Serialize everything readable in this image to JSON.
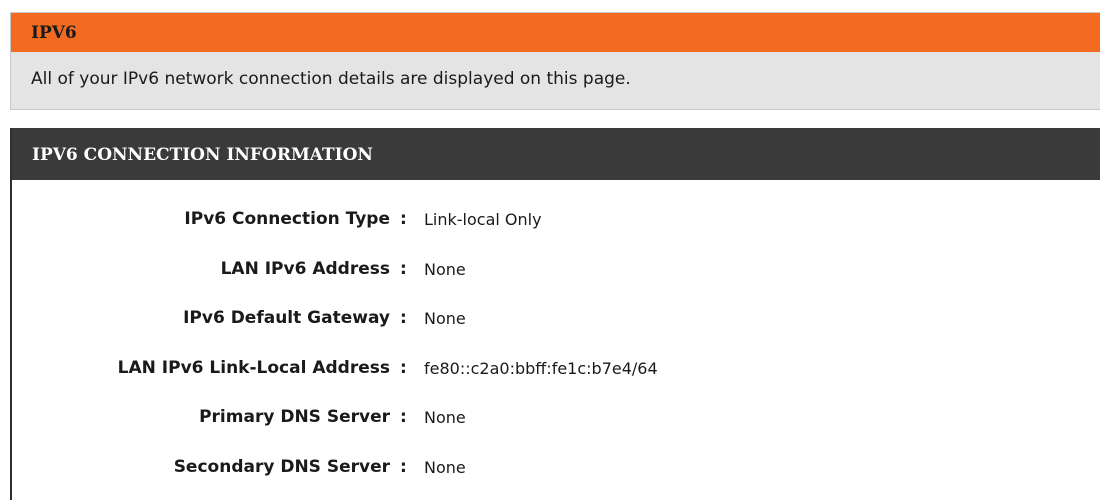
{
  "colors": {
    "accent": "#f26b21",
    "section_header_bg": "#3a3a3a",
    "intro_bg": "#e4e4e4"
  },
  "intro": {
    "title": "IPV6",
    "description": "All of your IPv6 network connection details are displayed on this page."
  },
  "connection_info": {
    "title": "IPV6 CONNECTION INFORMATION",
    "separator": ":",
    "rows": [
      {
        "label": "IPv6 Connection Type",
        "value": "Link-local Only"
      },
      {
        "label": "LAN IPv6 Address",
        "value": "None"
      },
      {
        "label": "IPv6 Default Gateway",
        "value": "None"
      },
      {
        "label": "LAN IPv6 Link-Local Address",
        "value": "fe80::c2a0:bbff:fe1c:b7e4/64"
      },
      {
        "label": "Primary DNS Server",
        "value": "None"
      },
      {
        "label": "Secondary DNS Server",
        "value": "None"
      }
    ]
  }
}
